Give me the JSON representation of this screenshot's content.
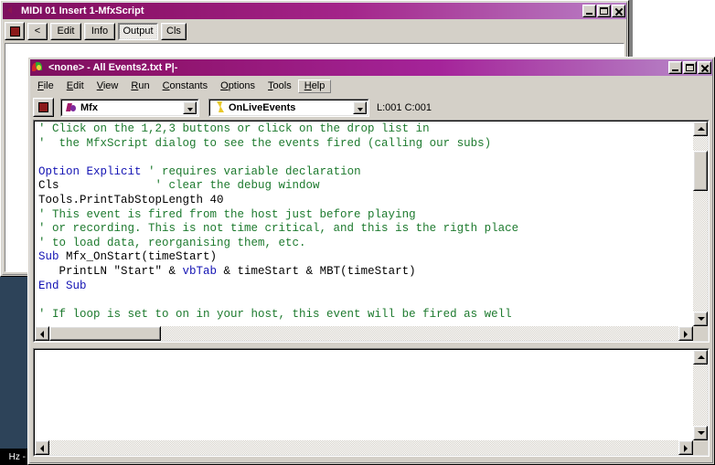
{
  "window1": {
    "title": "MIDI 01 Insert 1-MfxScript",
    "sysicon": "left-arrow-icon",
    "titlebar_buttons": [
      {
        "name": "minimize-button",
        "glyph": "minimize-icon"
      },
      {
        "name": "maximize-button",
        "glyph": "maximize-icon"
      },
      {
        "name": "close-button",
        "glyph": "close-icon"
      }
    ],
    "toolbar": {
      "stop_button": "stop-icon",
      "back_label": "<",
      "edit_label": "Edit",
      "info_label": "Info",
      "output_label": "Output",
      "cls_label": "Cls"
    }
  },
  "window2": {
    "title": "<none> - All Events2.txt P|-",
    "sysicon": "leaf-icon",
    "titlebar_buttons": [
      {
        "name": "minimize-button",
        "glyph": "minimize-icon"
      },
      {
        "name": "maximize-button",
        "glyph": "maximize-icon"
      },
      {
        "name": "close-button",
        "glyph": "close-icon"
      }
    ],
    "menu": [
      {
        "accel": "F",
        "rest": "ile",
        "active": false
      },
      {
        "accel": "E",
        "rest": "dit",
        "active": false
      },
      {
        "accel": "V",
        "rest": "iew",
        "active": false
      },
      {
        "accel": "R",
        "rest": "un",
        "active": false
      },
      {
        "accel": "C",
        "rest": "onstants",
        "active": false
      },
      {
        "accel": "O",
        "rest": "ptions",
        "active": false
      },
      {
        "accel": "T",
        "rest": "ools",
        "active": false
      },
      {
        "accel": "H",
        "rest": "elp",
        "active": true
      }
    ],
    "toolbar": {
      "stop_button": "stop-icon",
      "object_combo": {
        "value": "Mfx",
        "icon": "mfx-icon"
      },
      "event_combo": {
        "value": "OnLiveEvents",
        "icon": "lightning-icon"
      },
      "status": "L:001 C:001"
    },
    "code_lines": [
      [
        {
          "t": "' Click on the 1,2,3 buttons or click on the drop list in",
          "c": "cm"
        }
      ],
      [
        {
          "t": "'  the MfxScript dialog to see the events fired (calling our subs)",
          "c": "cm"
        }
      ],
      [
        {
          "t": "",
          "c": "tx"
        }
      ],
      [
        {
          "t": "Option Explicit",
          "c": "kw"
        },
        {
          "t": " ' requires variable declaration",
          "c": "cm"
        }
      ],
      [
        {
          "t": "Cls",
          "c": "tx"
        },
        {
          "t": "              ' clear the debug window",
          "c": "cm"
        }
      ],
      [
        {
          "t": "Tools.PrintTabStopLength 40",
          "c": "tx"
        }
      ],
      [
        {
          "t": "' This event is fired from the host just before playing",
          "c": "cm"
        }
      ],
      [
        {
          "t": "' or recording. This is not time critical, and this is the rigth place",
          "c": "cm"
        }
      ],
      [
        {
          "t": "' to load data, reorganising them, etc.",
          "c": "cm"
        }
      ],
      [
        {
          "t": "Sub",
          "c": "kw"
        },
        {
          "t": " Mfx_OnStart(timeStart)",
          "c": "tx"
        }
      ],
      [
        {
          "t": "   PrintLN \"Start\" & ",
          "c": "tx"
        },
        {
          "t": "vbTab",
          "c": "kw"
        },
        {
          "t": " & timeStart & MBT(timeStart)",
          "c": "tx"
        }
      ],
      [
        {
          "t": "End Sub",
          "c": "kw"
        }
      ],
      [
        {
          "t": "",
          "c": "tx"
        }
      ],
      [
        {
          "t": "' If loop is set to on in your host, this event will be fired as well",
          "c": "cm"
        }
      ]
    ],
    "output_text": ""
  },
  "background": {
    "status_text": "Hz -"
  },
  "colors": {
    "title_active_start": "#7d0f5e",
    "title_active_end": "#b97fc6",
    "face": "#d4d0c8",
    "comment_green": "#1d7a2e",
    "keyword_blue": "#1414b4",
    "stop_red": "#8b1a1a",
    "panel_blue": "#2d4359"
  }
}
